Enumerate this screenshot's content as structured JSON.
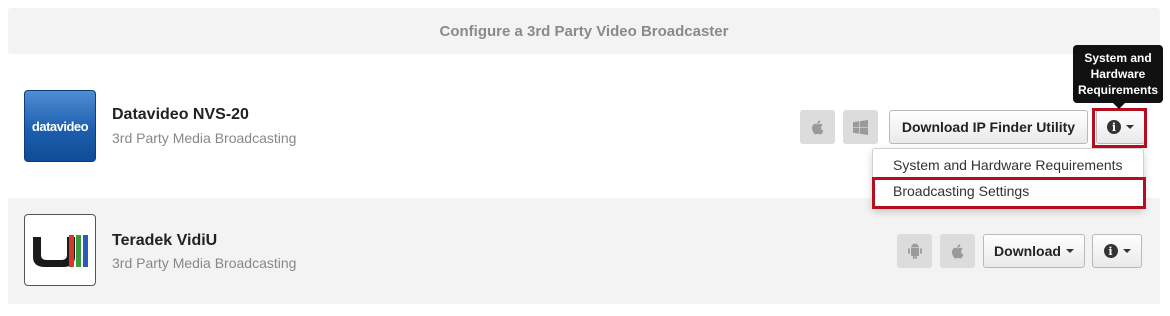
{
  "header": {
    "title": "Configure a 3rd Party Video Broadcaster"
  },
  "broadcasters": [
    {
      "name": "Datavideo NVS-20",
      "subtitle": "3rd Party Media Broadcasting",
      "logo_text": "datavideo",
      "platform_icons": [
        "apple-icon",
        "windows-icon"
      ],
      "download_label": "Download IP Finder Utility"
    },
    {
      "name": "Teradek VidiU",
      "subtitle": "3rd Party Media Broadcasting",
      "logo_text": "",
      "platform_icons": [
        "android-icon",
        "apple-icon"
      ],
      "download_label": "Download"
    }
  ],
  "tooltip": {
    "text": "System and Hardware Requirements"
  },
  "info_menu": {
    "items": [
      "System and Hardware Requirements",
      "Broadcasting Settings"
    ]
  },
  "colors": {
    "highlight": "#b50e20",
    "header_bg": "#f3f3f3",
    "logo_blue": "#1c5fae"
  }
}
